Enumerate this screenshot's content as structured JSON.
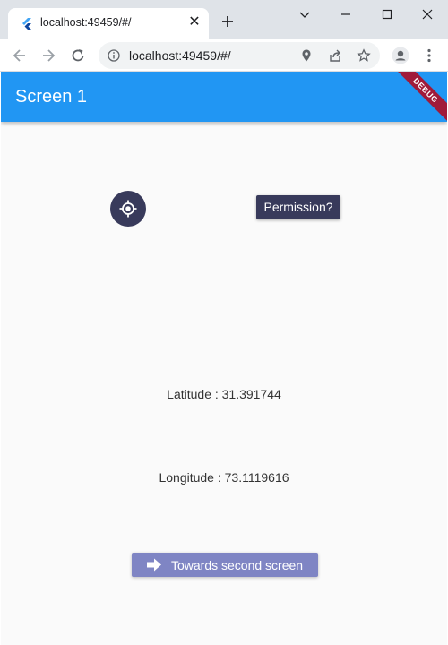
{
  "browser": {
    "tab_title": "localhost:49459/#/",
    "tab_close": "✕",
    "url": "localhost:49459/#/",
    "icons": [
      "flutter-favicon",
      "close-icon",
      "plus-icon",
      "chevron-down-icon",
      "minimize-icon",
      "maximize-icon",
      "close-window-icon",
      "back-arrow-icon",
      "forward-arrow-icon",
      "reload-icon",
      "info-icon",
      "location-pin-icon",
      "share-icon",
      "star-icon",
      "profile-icon",
      "more-vert-icon"
    ]
  },
  "app": {
    "title": "Screen 1",
    "debug_banner": "DEBUG",
    "permission_label": "Permission?",
    "latitude_text": "Latitude : 31.391744",
    "longitude_text": "Longitude : 73.1119616",
    "second_screen_label": "Towards second screen",
    "colors": {
      "appbar": "#2196f3",
      "dark_button": "#383a5b",
      "indigo_button": "#7f85c4",
      "background": "#fafafa"
    }
  }
}
